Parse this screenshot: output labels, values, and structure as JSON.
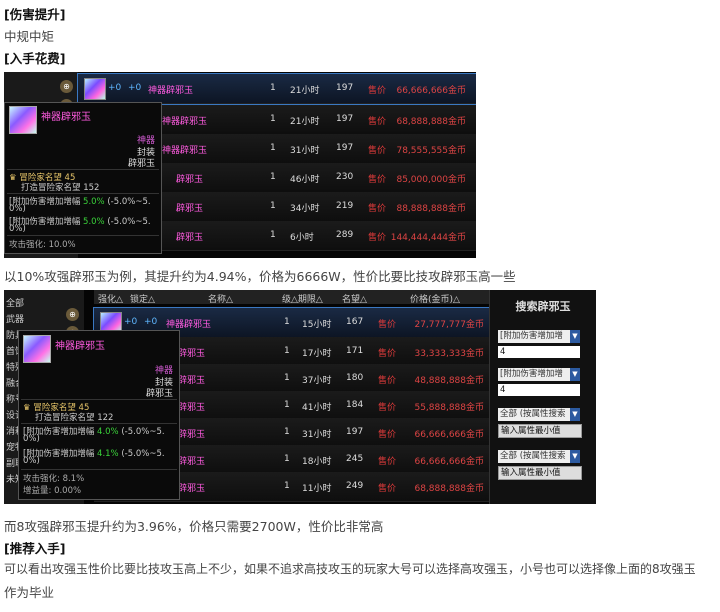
{
  "text": {
    "h1": "[伤害提升]",
    "p1": "中规中矩",
    "h2": "[入手花费]",
    "cap1": "以10%攻强辟邪玉为例，其提升约为4.94%，价格为6666W，性价比要比技攻辟邪玉高一些",
    "cap2": "而8攻强辟邪玉提升约为3.96%，价格只需要2700W，性价比非常高",
    "h3": "[推荐入手]",
    "p3a": "可以看出攻强玉性价比要比技攻玉高上不少，如果不追求高技攻玉的玩家大号可以选择高攻强玉，小号也可以选择像上面的8攻强玉",
    "p3b": "作为毕业"
  },
  "shot1": {
    "rows": [
      {
        "name": "神器辟邪玉",
        "plus1": "+0",
        "plus2": "+0",
        "qty": "1",
        "time": "21小时",
        "fame": "197",
        "sell": "售价",
        "price": "66,666,666金币"
      },
      {
        "name": "神器辟邪玉",
        "qty": "1",
        "time": "21小时",
        "fame": "197",
        "sell": "售价",
        "price": "68,888,888金币"
      },
      {
        "name": "神器辟邪玉",
        "qty": "1",
        "time": "31小时",
        "fame": "197",
        "sell": "售价",
        "price": "78,555,555金币"
      },
      {
        "name": "辟邪玉",
        "qty": "1",
        "time": "46小时",
        "fame": "230",
        "sell": "售价",
        "price": "85,000,000金币"
      },
      {
        "name": "辟邪玉",
        "qty": "1",
        "time": "34小时",
        "fame": "219",
        "sell": "售价",
        "price": "88,888,888金币"
      },
      {
        "name": "辟邪玉",
        "qty": "1",
        "time": "6小时",
        "fame": "289",
        "sell": "售价",
        "price": "144,444,444金币"
      }
    ],
    "tooltip": {
      "title": "神器辟邪玉",
      "rarity": "神器",
      "type": "封装",
      "subtype": "辟邪玉",
      "fame_label1": "冒险家名望 45",
      "fame_label2": "打造冒险家名望 152",
      "stat1a": "[附加伤害增加增幅",
      "stat1b": "5.0%",
      "stat1c": "(-5.0%~5.",
      "stat1d": "0%)",
      "stat2a": "[附加伤害增加增幅",
      "stat2b": "5.0%",
      "stat2c": "(-5.0%~5.",
      "stat2d": "0%)",
      "attack": "攻击强化: 10.0%"
    }
  },
  "shot2": {
    "side_items": [
      "全部",
      "武器",
      "防具",
      "首饰",
      "特殊",
      "融合",
      "称号",
      "设计",
      "消耗",
      "宠物",
      "副职",
      "未知"
    ],
    "headers": [
      "强化△",
      "锁定△",
      "名称△",
      "级△期限△",
      "名望△",
      "价格(金币)△"
    ],
    "rows": [
      {
        "name": "神器辟邪玉",
        "plus1": "+0",
        "plus2": "+0",
        "qty": "1",
        "time": "15小时",
        "fame": "167",
        "sell": "售价",
        "price": "27,777,777金币"
      },
      {
        "name": "辟邪玉",
        "qty": "1",
        "time": "17小时",
        "fame": "171",
        "sell": "售价",
        "price": "33,333,333金币"
      },
      {
        "name": "辟邪玉",
        "qty": "1",
        "time": "37小时",
        "fame": "180",
        "sell": "售价",
        "price": "48,888,888金币"
      },
      {
        "name": "辟邪玉",
        "qty": "1",
        "time": "41小时",
        "fame": "184",
        "sell": "售价",
        "price": "55,888,888金币"
      },
      {
        "name": "辟邪玉",
        "qty": "1",
        "time": "31小时",
        "fame": "197",
        "sell": "售价",
        "price": "66,666,666金币"
      },
      {
        "name": "辟邪玉",
        "qty": "1",
        "time": "18小时",
        "fame": "245",
        "sell": "售价",
        "price": "66,666,666金币"
      },
      {
        "name": "辟邪玉",
        "qty": "1",
        "time": "11小时",
        "fame": "249",
        "sell": "售价",
        "price": "68,888,888金币"
      }
    ],
    "tooltip": {
      "title": "神器辟邪玉",
      "rarity": "神器",
      "type": "封装",
      "subtype": "辟邪玉",
      "fame_label1": "冒险家名望 45",
      "fame_label2": "打造冒险家名望 122",
      "stat1a": "[附加伤害增加增幅",
      "stat1b": "4.0%",
      "stat1c": "(-5.0%~5.",
      "stat1d": "0%)",
      "stat2a": "[附加伤害增加增幅",
      "stat2b": "4.1%",
      "stat2c": "(-5.0%~5.",
      "stat2d": "0%)",
      "attack": "攻击强化: 8.1%",
      "gain": "增益量: 0.00%"
    },
    "panel": {
      "title": "搜索辟邪玉",
      "select1": "[附加伤害增加增",
      "input1": "4",
      "select2": "[附加伤害增加增",
      "input2": "4",
      "select3": "全部 (按属性搜索",
      "btn1": "输入属性最小值",
      "select4": "全部 (按属性搜索",
      "btn2": "输入属性最小值"
    }
  }
}
